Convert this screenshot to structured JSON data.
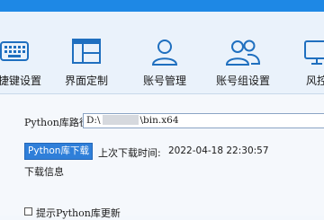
{
  "toolbar": {
    "items": [
      {
        "label": "快捷键设置",
        "icon": "keyboard-icon"
      },
      {
        "label": "界面定制",
        "icon": "layout-icon"
      },
      {
        "label": "账号管理",
        "icon": "user-icon"
      },
      {
        "label": "账号组设置",
        "icon": "users-icon"
      },
      {
        "label": "风控",
        "icon": "monitor-icon"
      }
    ]
  },
  "colors": {
    "accent": "#1e88e5",
    "icon_stroke": "#1f6fbf",
    "button_bg": "#2f7fd9"
  },
  "python": {
    "path_label": "Python库路径",
    "path_prefix": "D:\\",
    "path_suffix": "\\bin.x64",
    "download_button": "Python库下载",
    "last_download_label": "上次下载时间:",
    "last_download_time": "2022-04-18 22:30:57",
    "download_info_label": "下载信息",
    "update_hint_label": "提示Python库更新"
  }
}
